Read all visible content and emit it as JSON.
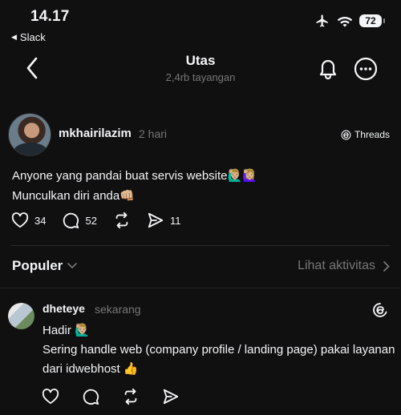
{
  "status_bar": {
    "time": "14.17",
    "back_app": "Slack",
    "battery": "72",
    "icons": [
      "airplane-icon",
      "wifi-icon",
      "battery-icon"
    ]
  },
  "header": {
    "title": "Utas",
    "subtitle": "2,4rb tayangan",
    "icons": [
      "back-chevron-icon",
      "bell-icon",
      "more-icon"
    ]
  },
  "post": {
    "username": "mkhairilazim",
    "time_ago": "2 hari",
    "source_label": "Threads",
    "lines": [
      "Anyone yang pandai buat servis website🙋🏼‍♂️🙋🏼‍♀️",
      "Munculkan diri anda👊🏼"
    ],
    "likes": "34",
    "replies": "52",
    "shares": "11"
  },
  "section": {
    "title": "Populer",
    "activity_link": "Lihat aktivitas"
  },
  "reply": {
    "username": "dheteye",
    "time_ago": "sekarang",
    "line1": "Hadir 🙋🏼‍♂️",
    "line2": "Sering handle web (company profile / landing page) pakai layanan dari idwebhost 👍"
  },
  "colors": {
    "background": "#101010",
    "text": "#f3f5f7",
    "muted": "#777777",
    "divider": "#2a2a2a"
  }
}
